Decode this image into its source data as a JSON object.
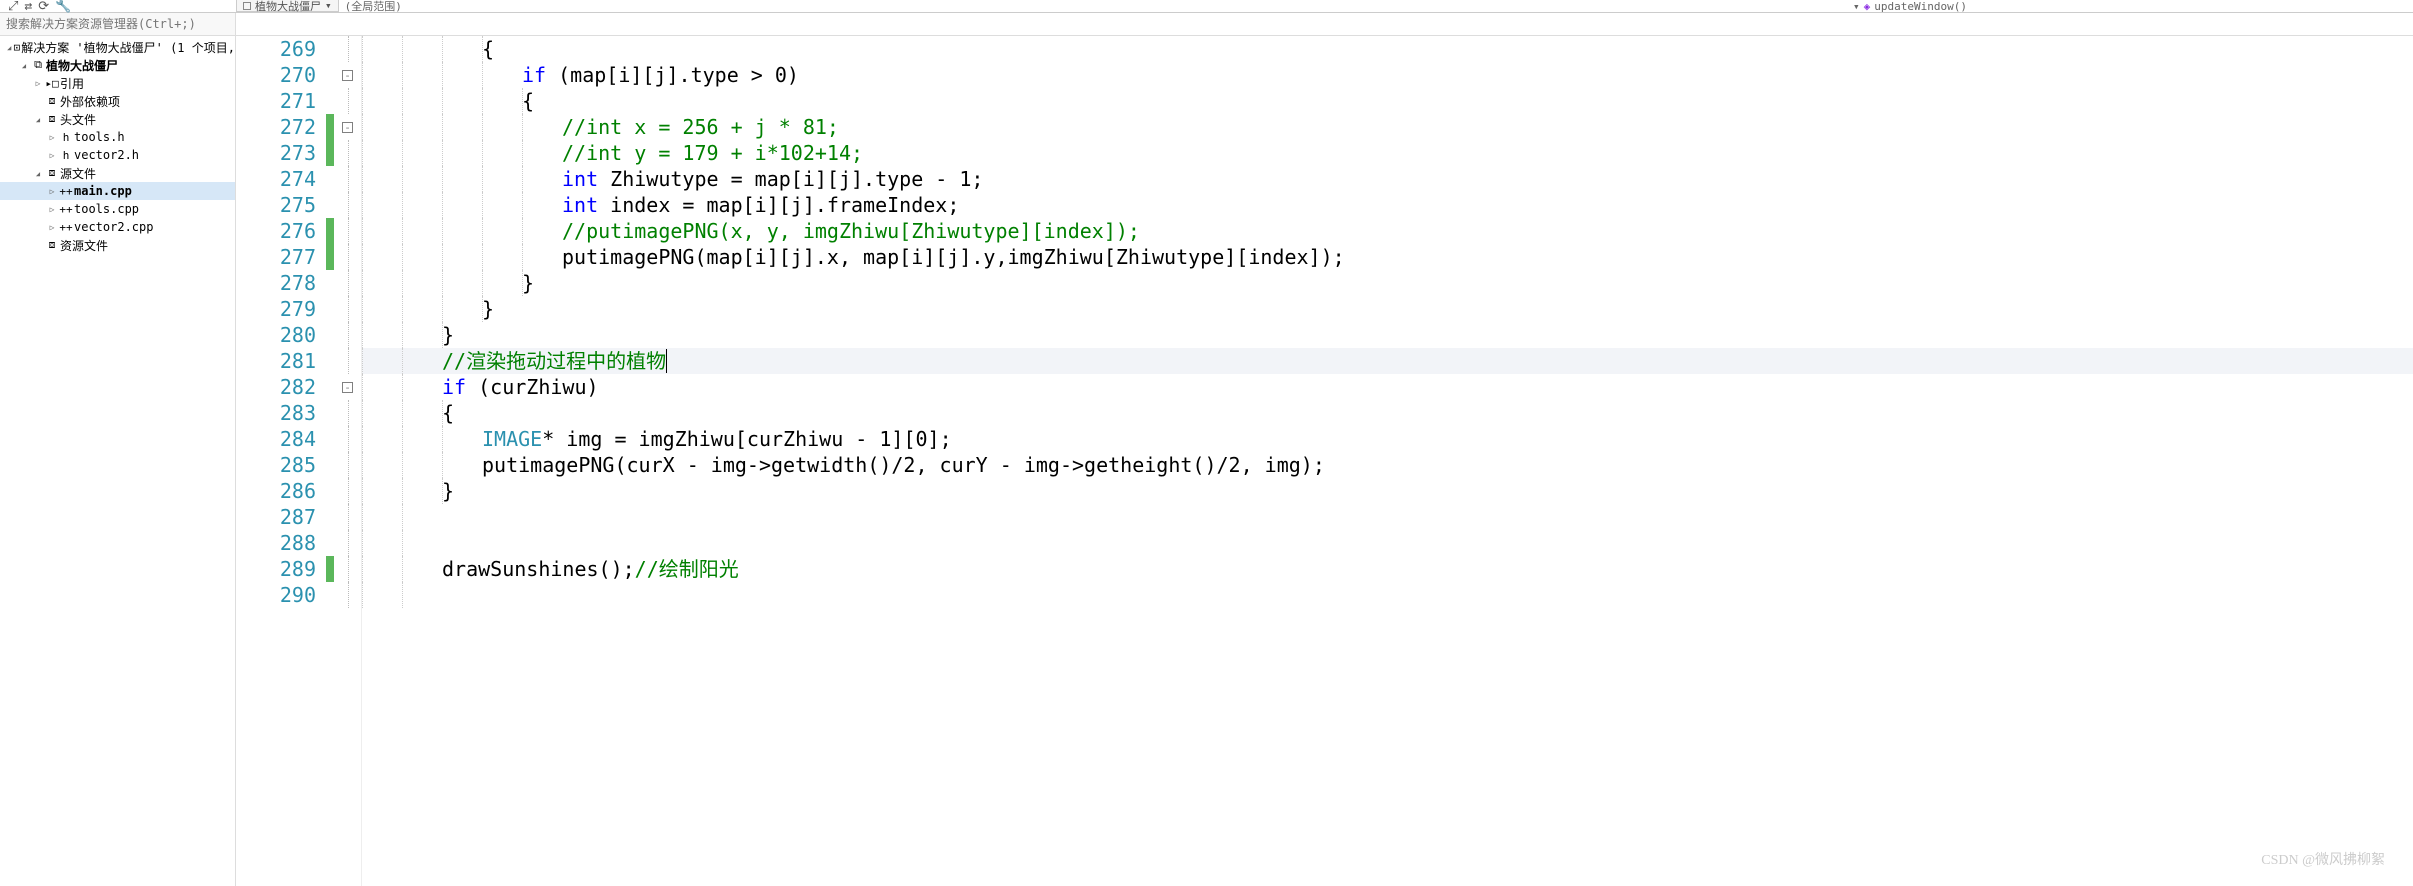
{
  "toolbar": {
    "tab_file": "植物大战僵尸",
    "context_dropdown": "(全局范围)",
    "function_dropdown": "updateWindow()"
  },
  "search": {
    "placeholder": "搜索解决方案资源管理器(Ctrl+;)"
  },
  "tree": [
    {
      "indent": 0,
      "arrow": "open",
      "icon": "⊡",
      "label": "解决方案 '植物大战僵尸' (1 个项目,",
      "bold": false
    },
    {
      "indent": 1,
      "arrow": "open",
      "icon": "⧉",
      "label": "植物大战僵尸",
      "bold": true
    },
    {
      "indent": 2,
      "arrow": "closed",
      "icon": "▸□",
      "label": "引用",
      "bold": false
    },
    {
      "indent": 2,
      "arrow": "",
      "icon": "⧈",
      "label": "外部依赖项",
      "bold": false
    },
    {
      "indent": 2,
      "arrow": "open",
      "icon": "⧈",
      "label": "头文件",
      "bold": false
    },
    {
      "indent": 3,
      "arrow": "closed",
      "icon": "h",
      "label": "tools.h",
      "bold": false
    },
    {
      "indent": 3,
      "arrow": "closed",
      "icon": "h",
      "label": "vector2.h",
      "bold": false
    },
    {
      "indent": 2,
      "arrow": "open",
      "icon": "⧈",
      "label": "源文件",
      "bold": false
    },
    {
      "indent": 3,
      "arrow": "closed",
      "icon": "++",
      "label": "main.cpp",
      "bold": true,
      "selected": true
    },
    {
      "indent": 3,
      "arrow": "closed",
      "icon": "++",
      "label": "tools.cpp",
      "bold": false
    },
    {
      "indent": 3,
      "arrow": "closed",
      "icon": "++",
      "label": "vector2.cpp",
      "bold": false
    },
    {
      "indent": 2,
      "arrow": "",
      "icon": "⧈",
      "label": "资源文件",
      "bold": false
    }
  ],
  "lines": [
    {
      "n": 269,
      "fold": "",
      "chg": "",
      "guides": [
        0,
        40,
        80,
        120
      ],
      "tokens": [
        {
          "ind": 120,
          "t": "{",
          "c": ""
        }
      ]
    },
    {
      "n": 270,
      "fold": "box",
      "chg": "",
      "guides": [
        0,
        40,
        80,
        120
      ],
      "tokens": [
        {
          "ind": 160,
          "t": "if",
          "c": "kw"
        },
        {
          "t": " (map[i][j].type > 0)",
          "c": ""
        }
      ]
    },
    {
      "n": 271,
      "fold": "",
      "chg": "",
      "guides": [
        0,
        40,
        80,
        120,
        160
      ],
      "tokens": [
        {
          "ind": 160,
          "t": "{",
          "c": ""
        }
      ]
    },
    {
      "n": 272,
      "fold": "box",
      "chg": "mod",
      "guides": [
        0,
        40,
        80,
        120,
        160
      ],
      "tokens": [
        {
          "ind": 200,
          "t": "//int x = 256 + j * 81;",
          "c": "cmt"
        }
      ]
    },
    {
      "n": 273,
      "fold": "",
      "chg": "mod",
      "guides": [
        0,
        40,
        80,
        120,
        160
      ],
      "tokens": [
        {
          "ind": 200,
          "t": "//int y = 179 + i*102+14;",
          "c": "cmt"
        }
      ]
    },
    {
      "n": 274,
      "fold": "",
      "chg": "",
      "guides": [
        0,
        40,
        80,
        120,
        160
      ],
      "tokens": [
        {
          "ind": 200,
          "t": "int",
          "c": "type"
        },
        {
          "t": " Zhiwutype = map[i][j].type - 1;",
          "c": ""
        }
      ]
    },
    {
      "n": 275,
      "fold": "",
      "chg": "",
      "guides": [
        0,
        40,
        80,
        120,
        160
      ],
      "tokens": [
        {
          "ind": 200,
          "t": "int",
          "c": "type"
        },
        {
          "t": " index = map[i][j].frameIndex;",
          "c": ""
        }
      ]
    },
    {
      "n": 276,
      "fold": "",
      "chg": "mod",
      "guides": [
        0,
        40,
        80,
        120,
        160
      ],
      "tokens": [
        {
          "ind": 200,
          "t": "//putimagePNG(x, y, imgZhiwu[Zhiwutype][index]);",
          "c": "cmt"
        }
      ]
    },
    {
      "n": 277,
      "fold": "",
      "chg": "mod",
      "guides": [
        0,
        40,
        80,
        120,
        160
      ],
      "tokens": [
        {
          "ind": 200,
          "t": "putimagePNG(map[i][j].x, map[i][j].y,imgZhiwu[Zhiwutype][index]);",
          "c": ""
        }
      ]
    },
    {
      "n": 278,
      "fold": "",
      "chg": "",
      "guides": [
        0,
        40,
        80,
        120,
        160
      ],
      "tokens": [
        {
          "ind": 160,
          "t": "}",
          "c": ""
        }
      ]
    },
    {
      "n": 279,
      "fold": "",
      "chg": "",
      "guides": [
        0,
        40,
        80,
        120
      ],
      "tokens": [
        {
          "ind": 120,
          "t": "}",
          "c": ""
        }
      ]
    },
    {
      "n": 280,
      "fold": "",
      "chg": "",
      "guides": [
        0,
        40,
        80
      ],
      "tokens": [
        {
          "ind": 80,
          "t": "}",
          "c": ""
        }
      ]
    },
    {
      "n": 281,
      "fold": "",
      "chg": "",
      "current": true,
      "guides": [
        0,
        40
      ],
      "tokens": [
        {
          "ind": 80,
          "t": "//渲染拖动过程中的植物",
          "c": "cmt",
          "caret": true
        }
      ]
    },
    {
      "n": 282,
      "fold": "box",
      "chg": "",
      "guides": [
        0,
        40
      ],
      "tokens": [
        {
          "ind": 80,
          "t": "if",
          "c": "kw"
        },
        {
          "t": " (curZhiwu)",
          "c": ""
        }
      ]
    },
    {
      "n": 283,
      "fold": "",
      "chg": "",
      "guides": [
        0,
        40,
        80
      ],
      "tokens": [
        {
          "ind": 80,
          "t": "{",
          "c": ""
        }
      ]
    },
    {
      "n": 284,
      "fold": "",
      "chg": "",
      "guides": [
        0,
        40,
        80
      ],
      "tokens": [
        {
          "ind": 120,
          "t": "IMAGE",
          "c": "cls"
        },
        {
          "t": "* img = imgZhiwu[curZhiwu - 1][0];",
          "c": ""
        }
      ]
    },
    {
      "n": 285,
      "fold": "",
      "chg": "",
      "guides": [
        0,
        40,
        80
      ],
      "tokens": [
        {
          "ind": 120,
          "t": "putimagePNG(curX - img->getwidth()/2, curY - img->getheight()/2, img);",
          "c": ""
        }
      ]
    },
    {
      "n": 286,
      "fold": "",
      "chg": "",
      "guides": [
        0,
        40,
        80
      ],
      "tokens": [
        {
          "ind": 80,
          "t": "}",
          "c": ""
        }
      ]
    },
    {
      "n": 287,
      "fold": "",
      "chg": "",
      "guides": [
        0,
        40
      ],
      "tokens": []
    },
    {
      "n": 288,
      "fold": "",
      "chg": "",
      "guides": [
        0,
        40
      ],
      "tokens": []
    },
    {
      "n": 289,
      "fold": "",
      "chg": "mod",
      "guides": [
        0,
        40
      ],
      "tokens": [
        {
          "ind": 80,
          "t": "drawSunshines();",
          "c": ""
        },
        {
          "t": "//绘制阳光",
          "c": "cmt"
        }
      ]
    },
    {
      "n": 290,
      "fold": "",
      "chg": "",
      "guides": [
        0,
        40
      ],
      "tokens": []
    }
  ],
  "watermark": "CSDN @微风拂柳絮"
}
